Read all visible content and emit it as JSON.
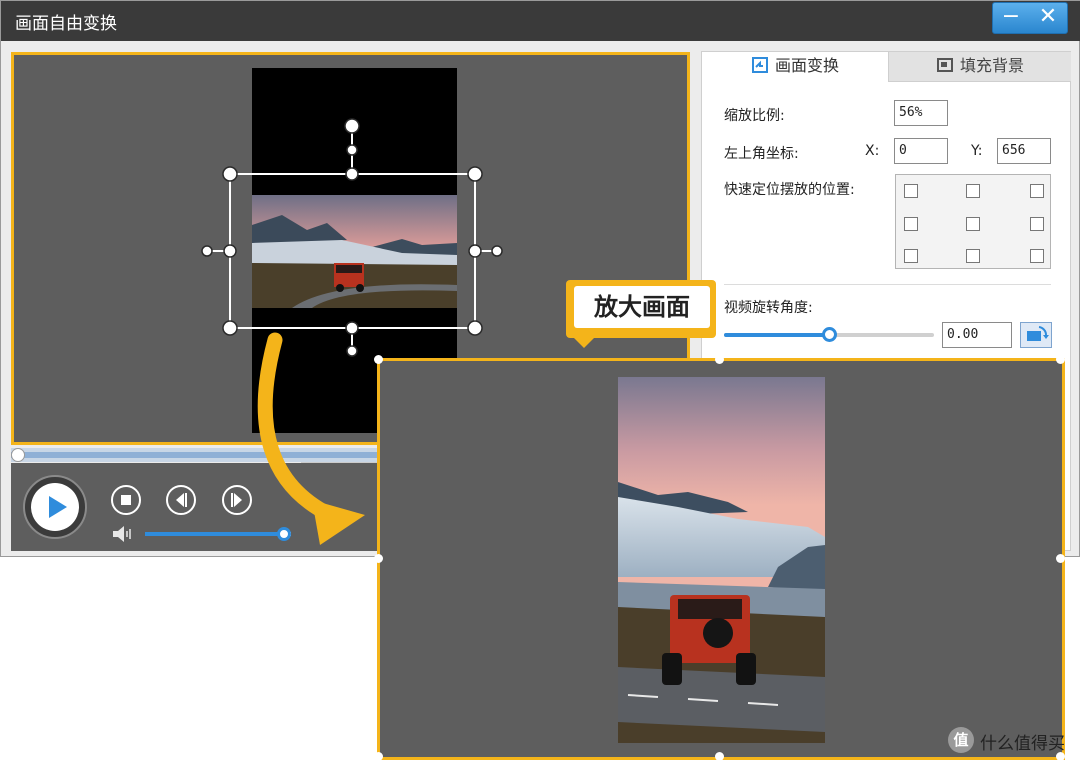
{
  "window": {
    "title": "画面自由变换",
    "minimize_glyph": "−",
    "close_glyph": "✕"
  },
  "preview": {
    "timeline_dropdown_glyph": "⌄"
  },
  "player": {
    "play_icon": "play-icon",
    "stop_icon": "stop-icon",
    "prev_frame_icon": "previous-frame-icon",
    "next_frame_icon": "next-frame-icon",
    "volume_icon": "speaker-icon",
    "volume_level": 0.95
  },
  "panel": {
    "tabs": [
      {
        "label": "画面变换",
        "icon": "transform-icon",
        "active": true
      },
      {
        "label": "填充背景",
        "icon": "fill-background-icon",
        "active": false
      }
    ],
    "scale_label": "缩放比例:",
    "scale_value": "56%",
    "coords_label": "左上角坐标:",
    "x_label": "X:",
    "x_value": "0",
    "y_label": "Y:",
    "y_value": "656",
    "quick_pos_label": "快速定位摆放的位置:",
    "rotation_label": "视频旋转角度:",
    "rotation_value": "0.00",
    "rotation_slider_level": 0.5,
    "rotate_button_icon": "rotate-icon"
  },
  "callout": {
    "text": "放大画面"
  },
  "watermark": {
    "icon_text": "值",
    "text": "什么值得买"
  },
  "colors": {
    "accent_yellow": "#f4b41a",
    "accent_blue": "#2f8cdc",
    "preview_bg": "#5e5e5e",
    "titlebar": "#3a3a3a"
  }
}
